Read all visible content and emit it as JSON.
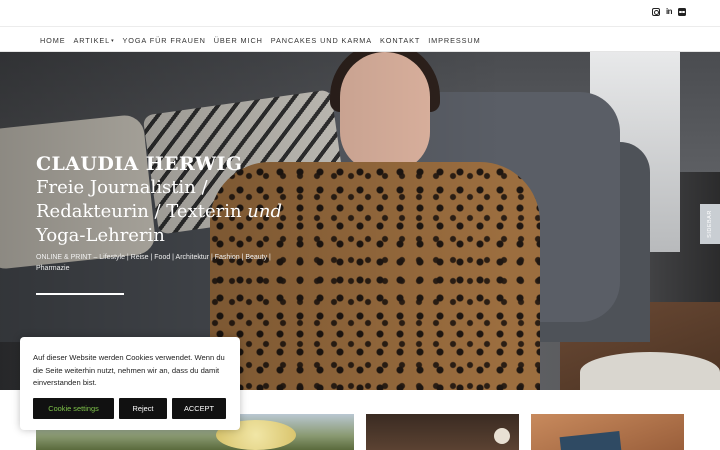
{
  "social": {
    "icons": [
      "instagram-icon",
      "linkedin-icon",
      "flickr-icon"
    ]
  },
  "nav": {
    "items": [
      "HOME",
      "ARTIKEL",
      "YOGA FÜR FRAUEN",
      "ÜBER MICH",
      "PANCAKES UND KARMA",
      "KONTAKT",
      "IMPRESSUM"
    ],
    "caret": "▾"
  },
  "hero": {
    "name": "CLAUDIA HERWIG",
    "role_a": "Freie Journalistin /",
    "role_b": "Redakteurin / Texterin",
    "role_und": "und",
    "role_c": "Yoga-Lehrerin",
    "subtitle": "ONLINE & PRINT – Lifestyle | Reise | Food | Architektur | Fashion | Beauty | Pharmazie"
  },
  "sidebar_tab": {
    "label": "SIDEBAR"
  },
  "cookie": {
    "text": "Auf dieser Website werden Cookies verwendet. Wenn du die Seite weiterhin nutzt, nehmen wir an, dass du damit einverstanden bist.",
    "settings_label": "Cookie settings",
    "reject_label": "Reject",
    "accept_label": "ACCEPT"
  },
  "colors": {
    "accent_green": "#7fc44a",
    "button_bg": "#111111",
    "sidebar_tab": "#c9ced3"
  }
}
